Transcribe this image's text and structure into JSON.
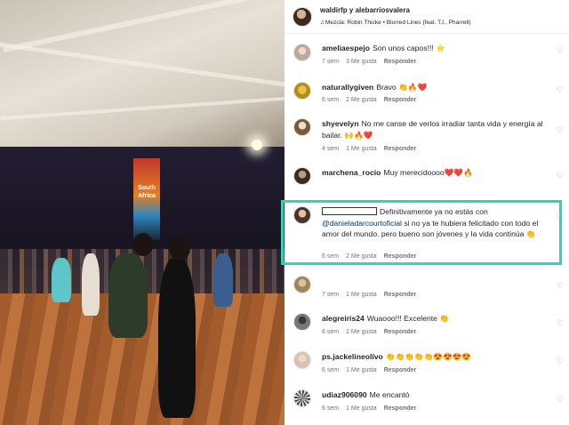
{
  "photo": {
    "banner_text": "South Africa"
  },
  "post": {
    "author": "waldirfp y alebarriosvalera",
    "song": "Mezcla: Robin Thicke • Blurred Lines (feat. T.I., Pharrell)"
  },
  "comments": [
    {
      "user": "ameliaespejo",
      "text": "Son unos capos!!! ⭐",
      "time": "7 sem",
      "likes": "3 Me gusta",
      "reply": "Responder"
    },
    {
      "user": "naturallygiven",
      "text": "Bravo 👏🔥❤️",
      "time": "6 sem",
      "likes": "2 Me gusta",
      "reply": "Responder"
    },
    {
      "user": "shyevelyn",
      "text": "No me canse de verlos irradiar tanta vida y energía al bailar. 🙌🔥❤️",
      "time": "4 sem",
      "likes": "1 Me gusta",
      "reply": "Responder"
    },
    {
      "user": "marchena_rocio",
      "text": "Muy merecidoooo❤️❤️🔥",
      "time": "6 sem",
      "likes": "",
      "reply": "Responder"
    },
    {
      "user": "",
      "text_before": "Definitivamente ya no estás con ",
      "mention": "@danieladarcourtoficial",
      "text_after": " si no ya te hubiera felicitado con todo el amor del mundo. pero bueno son jóvenes y la vida continúa 👏",
      "time": "6 sem",
      "likes": "2 Me gusta",
      "reply": "Responder"
    },
    {
      "user": "",
      "text": "",
      "time": "7 sem",
      "likes": "1 Me gusta",
      "reply": "Responder"
    },
    {
      "user": "alegreiris24",
      "text": "Wuaooo!!! Excelente 👏",
      "time": "6 sem",
      "likes": "2 Me gusta",
      "reply": "Responder"
    },
    {
      "user": "ps.jackelineolivo",
      "text": "👏👏👏👏👏😍😍😍😍",
      "time": "6 sem",
      "likes": "1 Me gusta",
      "reply": "Responder"
    },
    {
      "user": "udiaz906090",
      "text": "Me encantó",
      "time": "6 sem",
      "likes": "1 Me gusta",
      "reply": "Responder"
    }
  ],
  "icons": {
    "like": "heart-outline-icon",
    "music": "music-note-icon"
  },
  "colors": {
    "highlight": "#2ed6b5",
    "mention": "#00376b",
    "meta": "#737373"
  }
}
